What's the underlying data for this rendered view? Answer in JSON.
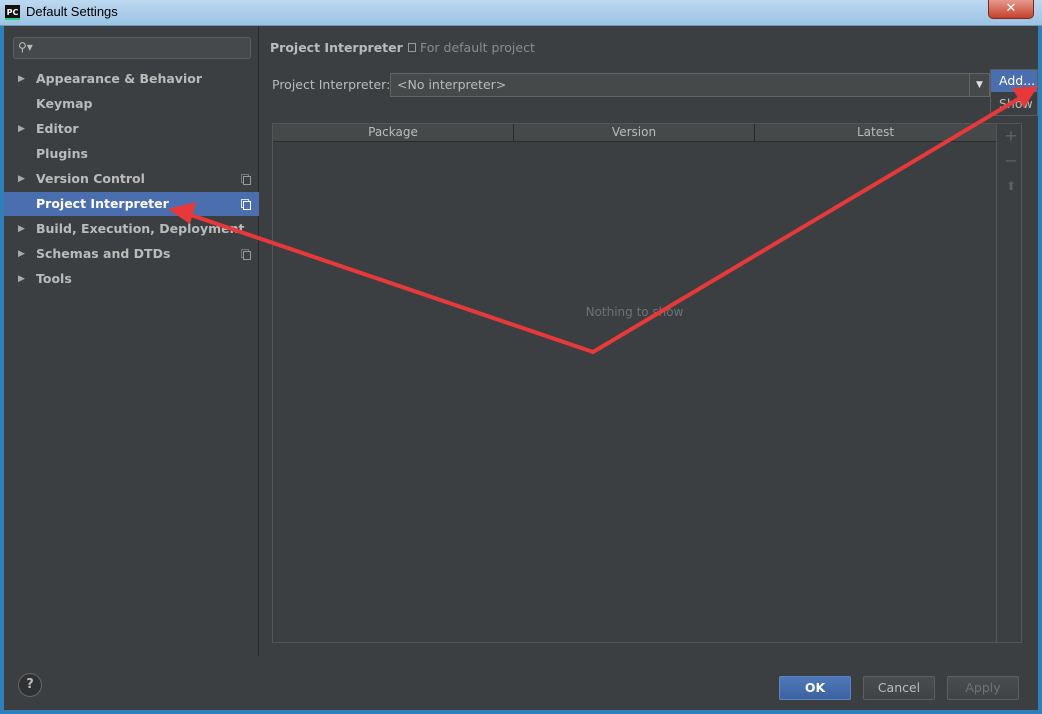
{
  "window": {
    "logo_text": "PC",
    "title": "Default Settings",
    "close_glyph": "✕"
  },
  "search": {
    "icon": "search-icon",
    "value": ""
  },
  "sidebar": {
    "items": [
      {
        "label": "Appearance & Behavior",
        "expandable": true,
        "copy_icon": false,
        "selected": false
      },
      {
        "label": "Keymap",
        "expandable": false,
        "copy_icon": false,
        "selected": false
      },
      {
        "label": "Editor",
        "expandable": true,
        "copy_icon": false,
        "selected": false
      },
      {
        "label": "Plugins",
        "expandable": false,
        "copy_icon": false,
        "selected": false
      },
      {
        "label": "Version Control",
        "expandable": true,
        "copy_icon": true,
        "selected": false
      },
      {
        "label": "Project Interpreter",
        "expandable": false,
        "copy_icon": true,
        "selected": true
      },
      {
        "label": "Build, Execution, Deployment",
        "expandable": true,
        "copy_icon": false,
        "selected": false
      },
      {
        "label": "Schemas and DTDs",
        "expandable": true,
        "copy_icon": true,
        "selected": false
      },
      {
        "label": "Tools",
        "expandable": true,
        "copy_icon": false,
        "selected": false
      }
    ]
  },
  "main": {
    "title": "Project Interpreter",
    "scope_label": "For default project",
    "interpreter_label": "Project Interpreter:",
    "interpreter_value": "<No interpreter>",
    "popup": {
      "items": [
        "Add...",
        "Show All..."
      ]
    },
    "table": {
      "columns": [
        "Package",
        "Version",
        "Latest"
      ],
      "empty_text": "Nothing to show"
    },
    "tools": {
      "add_glyph": "+",
      "remove_glyph": "−",
      "upgrade_glyph": "⬆"
    }
  },
  "footer": {
    "help_glyph": "?",
    "ok_label": "OK",
    "cancel_label": "Cancel",
    "apply_label": "Apply"
  },
  "colors": {
    "accent": "#4b6eaf",
    "annotation": "#e8393a",
    "background": "#3c3f41"
  }
}
